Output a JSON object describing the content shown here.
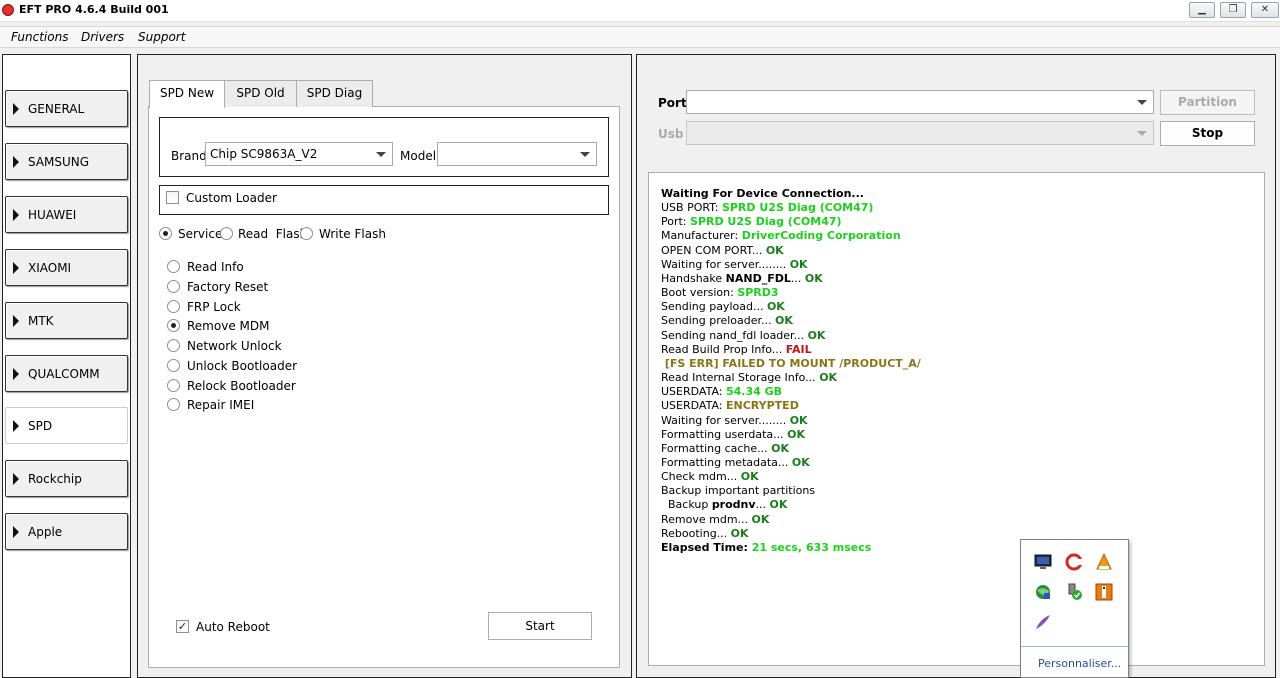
{
  "window": {
    "title": "EFT PRO 4.6.4 Build 001",
    "btn_min": "▁",
    "btn_max": "❐",
    "btn_close": "✕"
  },
  "menu": [
    "Functions",
    "Drivers",
    "Support"
  ],
  "sidebar": {
    "items": [
      "GENERAL",
      "SAMSUNG",
      "HUAWEI",
      "XIAOMI",
      "MTK",
      "QUALCOMM",
      "SPD",
      "Rockchip",
      "Apple"
    ],
    "active": "SPD"
  },
  "tabs": [
    "SPD New",
    "SPD Old",
    "SPD Diag"
  ],
  "brand": {
    "label": "Brand",
    "value": "Chip SC9863A_V2",
    "model_label": "Model",
    "model_value": ""
  },
  "custom_loader": {
    "label": "Custom Loader",
    "checked": false
  },
  "modes": {
    "options": [
      "Service",
      "Read  Flash",
      "Write Flash"
    ],
    "selected": "Service"
  },
  "operations": {
    "options": [
      "Read Info",
      "Factory Reset",
      "FRP Lock",
      "Remove MDM",
      "Network Unlock",
      "Unlock Bootloader",
      "Relock Bootloader",
      "Repair IMEI"
    ],
    "selected": "Remove MDM"
  },
  "auto_reboot": {
    "label": "Auto Reboot",
    "checked": true
  },
  "start_label": "Start",
  "port": {
    "port_label": "Port",
    "port_value": "",
    "usb_label": "Usb",
    "partition_label": "Partition",
    "stop_label": "Stop"
  },
  "log": {
    "l1": "Waiting For Device Connection...",
    "l2a": "USB PORT: ",
    "l2b": "SPRD U2S Diag (COM47)",
    "l3a": "Port: ",
    "l3b": "SPRD U2S Diag (COM47)",
    "l4a": "Manufacturer: ",
    "l4b": "DriverCoding Corporation",
    "l5a": "OPEN COM PORT... ",
    "l5b": "OK",
    "l6a": "Waiting for server........ ",
    "l6b": "OK",
    "l7a": "Handshake ",
    "l7b": "NAND_FDL",
    "l7c": "... ",
    "l7d": "OK",
    "l8a": "Boot version: ",
    "l8b": "SPRD3",
    "l9a": "Sending payload... ",
    "l9b": "OK",
    "l10a": "Sending preloader... ",
    "l10b": "OK",
    "l11a": "Sending nand_fdl loader... ",
    "l11b": "OK",
    "l12a": "Read Build Prop Info... ",
    "l12b": "FAIL",
    "l13": " [FS ERR] FAILED TO MOUNT /PRODUCT_A/",
    "l14a": "Read Internal Storage Info... ",
    "l14b": "OK",
    "l15a": "USERDATA: ",
    "l15b": "54.34 GB",
    "l16a": "USERDATA: ",
    "l16b": "ENCRYPTED",
    "l17a": "Waiting for server........ ",
    "l17b": "OK",
    "l18a": "Formatting userdata... ",
    "l18b": "OK",
    "l19a": "Formatting cache... ",
    "l19b": "OK",
    "l20a": "Formatting metadata... ",
    "l20b": "OK",
    "l21a": "Check mdm... ",
    "l21b": "OK",
    "l22": "Backup important partitions",
    "l23a": "  Backup ",
    "l23b": "prodnv",
    "l23c": "... ",
    "l23d": "OK",
    "l24a": "Remove mdm... ",
    "l24b": "OK",
    "l25a": "Rebooting... ",
    "l25b": "OK",
    "l26a": "Elapsed Time: ",
    "l26b": "21 secs, 633 msecs"
  },
  "tray": {
    "link": "Personnaliser...",
    "icons": [
      "monitor-icon",
      "ccleaner-icon",
      "vlc-icon",
      "network-globe-icon",
      "usb-safe-remove-icon",
      "archive-icon",
      "feather-icon"
    ]
  },
  "colors": {
    "ok_green": "#1a7d1a",
    "bright_green": "#1bd11b",
    "fail_red": "#c0161d",
    "warn_olive": "#8a7417"
  }
}
